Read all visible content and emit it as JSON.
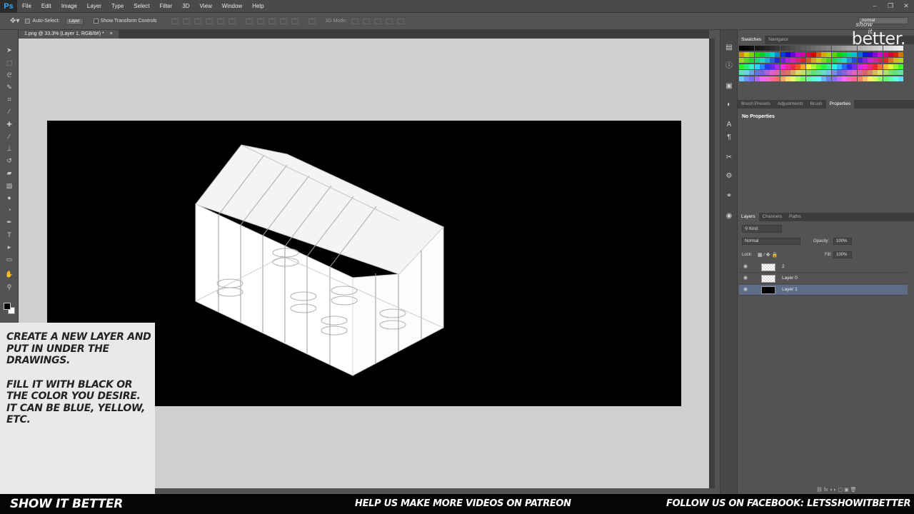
{
  "app": {
    "logo": "Ps"
  },
  "menu": [
    "File",
    "Edit",
    "Image",
    "Layer",
    "Type",
    "Select",
    "Filter",
    "3D",
    "View",
    "Window",
    "Help"
  ],
  "window_controls": [
    "–",
    "❐",
    "✕"
  ],
  "options_bar": {
    "auto_select_label": "Auto-Select:",
    "auto_select_value": "Layer",
    "transform_label": "Show Transform Controls",
    "mode_3d_label": "3D Mode:",
    "workspace_value": "normal"
  },
  "document": {
    "tab_title": "1.png @ 33,3% (Layer 1, RGB/8#) *",
    "tab_close": "×"
  },
  "tool_icons": [
    "move-icon",
    "marquee-icon",
    "lasso-icon",
    "quick-select-icon",
    "crop-icon",
    "eyedropper-icon",
    "healing-icon",
    "brush-icon",
    "stamp-icon",
    "history-brush-icon",
    "eraser-icon",
    "gradient-icon",
    "blur-icon",
    "dodge-icon",
    "pen-icon",
    "type-icon",
    "path-select-icon",
    "shape-icon",
    "hand-icon",
    "zoom-icon"
  ],
  "panels": {
    "swatches_tabs": [
      "Swatches",
      "Navigator"
    ],
    "properties_tabs": [
      "Brush Presets",
      "Adjustments",
      "Brush",
      "Properties"
    ],
    "properties_text": "No Properties",
    "layers_tabs": [
      "Layers",
      "Channels",
      "Paths"
    ],
    "filter_kind": "Kind",
    "blend_mode": "Normal",
    "opacity_label": "Opacity:",
    "opacity_value": "100%",
    "lock_label": "Lock:",
    "fill_label": "Fill:",
    "fill_value": "100%",
    "layers": [
      {
        "name": "2",
        "thumb": "checker",
        "selected": false
      },
      {
        "name": "Layer 0",
        "thumb": "checker",
        "selected": false
      },
      {
        "name": "Layer 1",
        "thumb": "black",
        "selected": true
      }
    ]
  },
  "watermark": {
    "small": "show it",
    "big": "better."
  },
  "instructions": {
    "line1": "CREATE A NEW LAYER AND PUT IN UNDER THE DRAWINGS.",
    "line2": "FILL IT WITH BLACK OR THE COLOR YOU DESIRE. IT CAN BE BLUE, YELLOW, ETC."
  },
  "footer": {
    "left": "SHOW IT BETTER",
    "center": "HELP US MAKE MORE VIDEOS ON PATREON",
    "right": "FOLLOW US ON FACEBOOK: LETSSHOWITBETTER"
  },
  "colors": {
    "canvas": "#000000",
    "workspace": "#cfcfcf",
    "selected_layer": "#5d6c87",
    "accent": "#31a8ff"
  }
}
